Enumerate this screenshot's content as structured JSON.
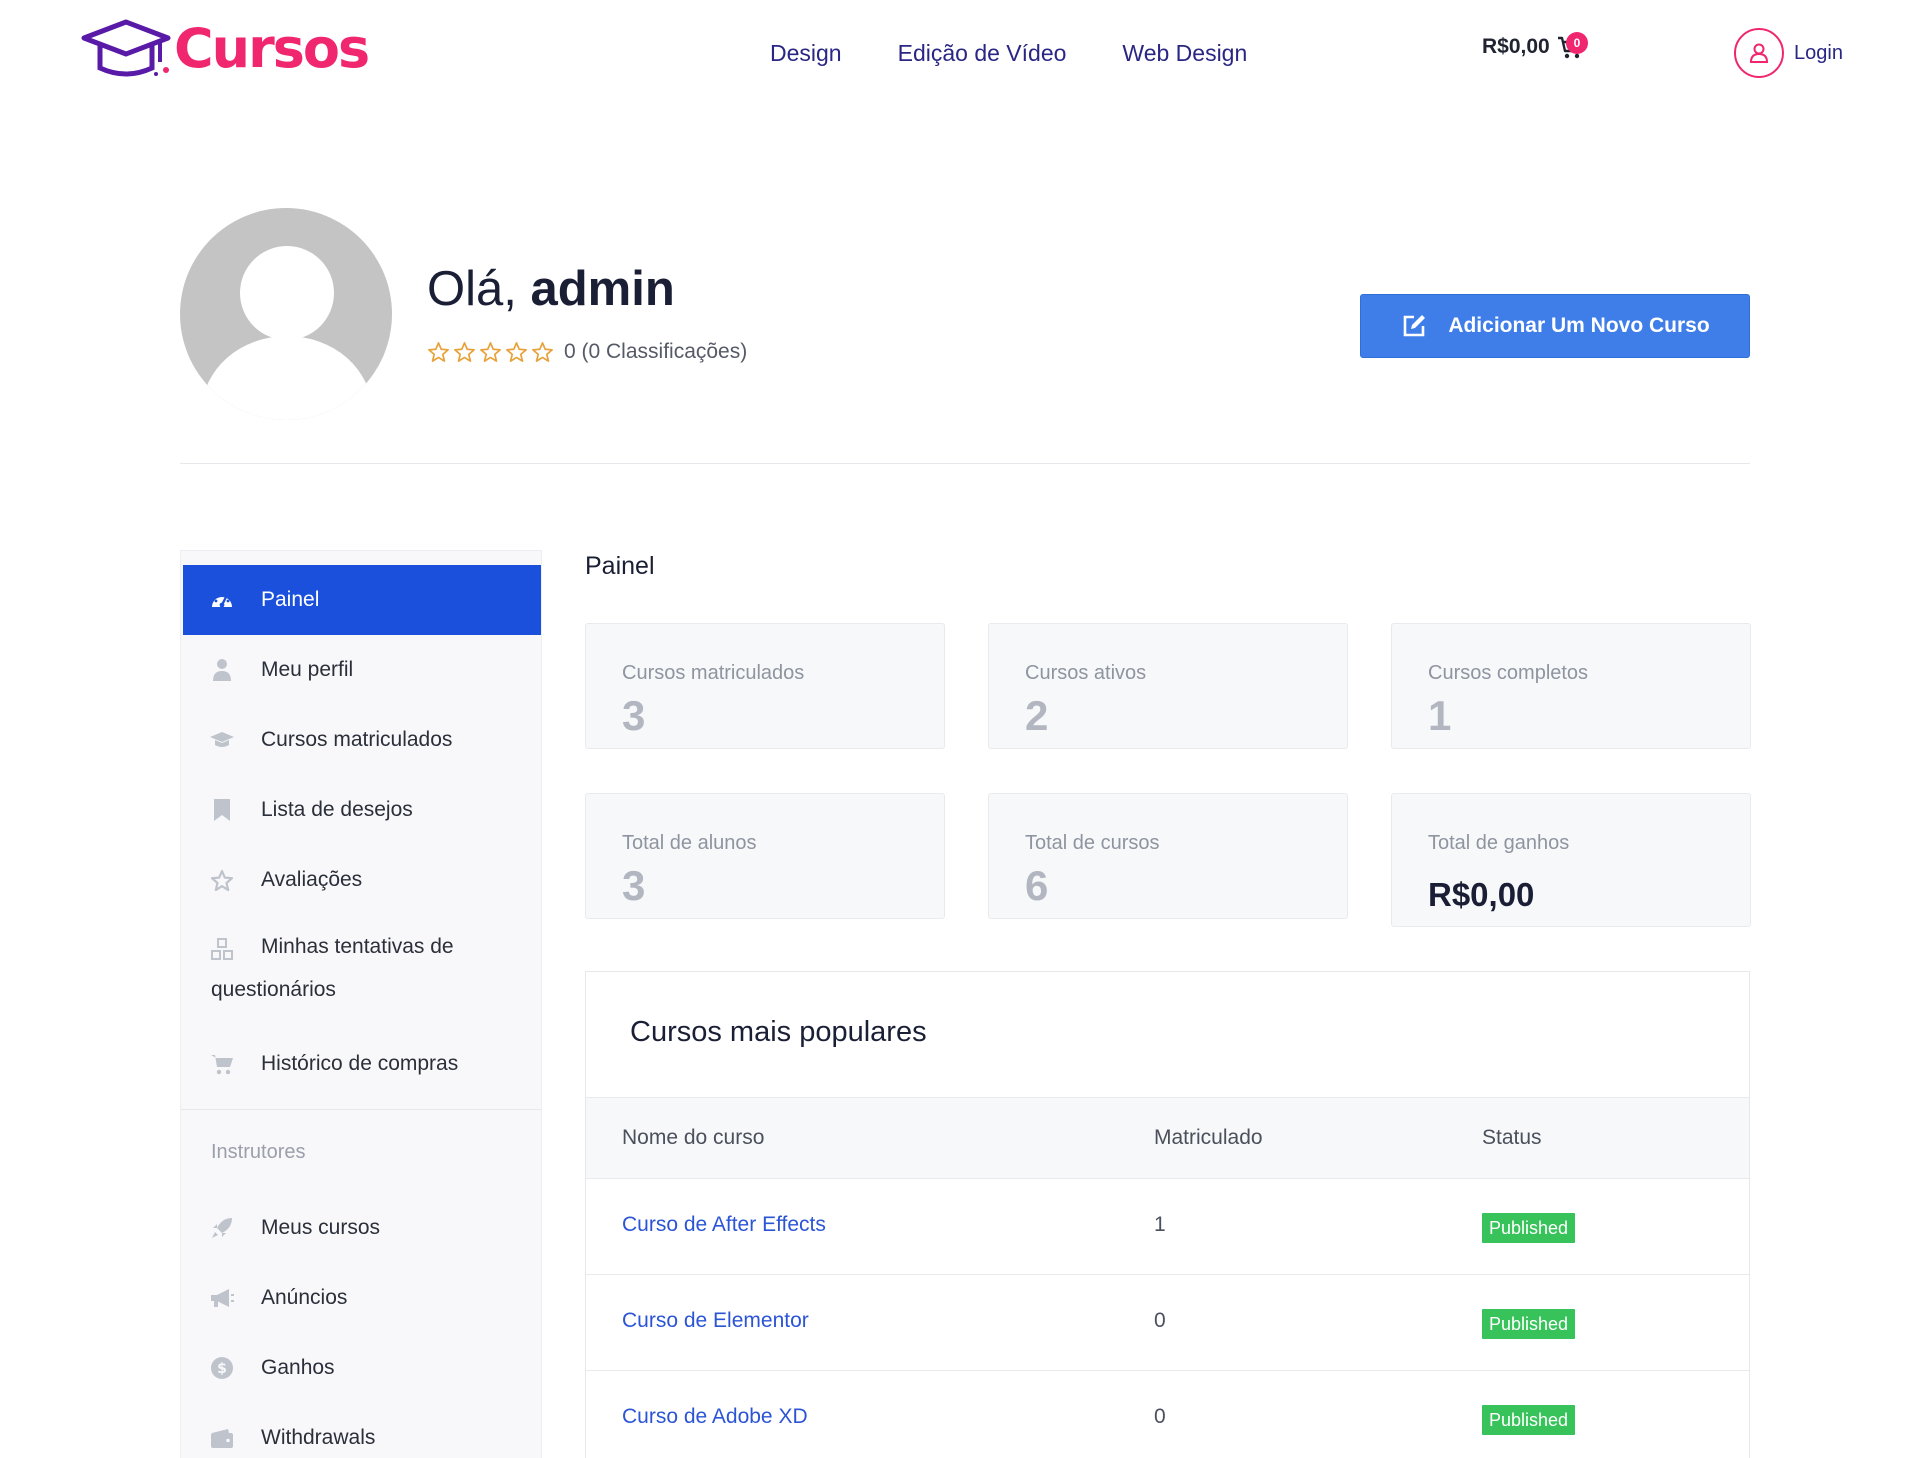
{
  "brand": {
    "name": "Cursos",
    "accent": "#f0266f",
    "nav_color": "#2a2784"
  },
  "nav": [
    {
      "label": "Design"
    },
    {
      "label": "Edição de Vídeo"
    },
    {
      "label": "Web Design"
    }
  ],
  "cart": {
    "total": "R$0,00",
    "count": "0"
  },
  "login": {
    "label": "Login"
  },
  "profile": {
    "greeting": "Olá,",
    "username": "admin",
    "rating_text": "0 (0 Classificações)",
    "rating_value": 0,
    "rating_max": 5
  },
  "actions": {
    "add_course": "Adicionar Um Novo Curso"
  },
  "sidebar": {
    "items": [
      {
        "label": "Painel",
        "icon": "dashboard-icon"
      },
      {
        "label": "Meu perfil",
        "icon": "user-icon"
      },
      {
        "label": "Cursos matriculados",
        "icon": "graduation-cap-icon"
      },
      {
        "label": "Lista de desejos",
        "icon": "bookmark-icon"
      },
      {
        "label": "Avaliações",
        "icon": "star-icon"
      },
      {
        "label": "Minhas tentativas de questionários",
        "icon": "quiz-icon"
      },
      {
        "label": "Histórico de compras",
        "icon": "cart-icon"
      }
    ],
    "instructor_section": "Instrutores",
    "instructor_items": [
      {
        "label": "Meus cursos",
        "icon": "rocket-icon"
      },
      {
        "label": "Anúncios",
        "icon": "megaphone-icon"
      },
      {
        "label": "Ganhos",
        "icon": "coin-icon"
      },
      {
        "label": "Withdrawals",
        "icon": "wallet-icon"
      }
    ]
  },
  "main": {
    "title": "Painel",
    "stats": [
      {
        "label": "Cursos matriculados",
        "value": "3"
      },
      {
        "label": "Cursos ativos",
        "value": "2"
      },
      {
        "label": "Cursos completos",
        "value": "1"
      },
      {
        "label": "Total de alunos",
        "value": "3"
      },
      {
        "label": "Total de cursos",
        "value": "6"
      },
      {
        "label": "Total de ganhos",
        "value": "R$0,00"
      }
    ],
    "popular": {
      "title": "Cursos mais populares",
      "columns": [
        "Nome do curso",
        "Matriculado",
        "Status"
      ],
      "rows": [
        {
          "name": "Curso de After Effects",
          "enrolled": "1",
          "status": "Published"
        },
        {
          "name": "Curso de Elementor",
          "enrolled": "0",
          "status": "Published"
        },
        {
          "name": "Curso de Adobe XD",
          "enrolled": "0",
          "status": "Published"
        }
      ]
    }
  }
}
